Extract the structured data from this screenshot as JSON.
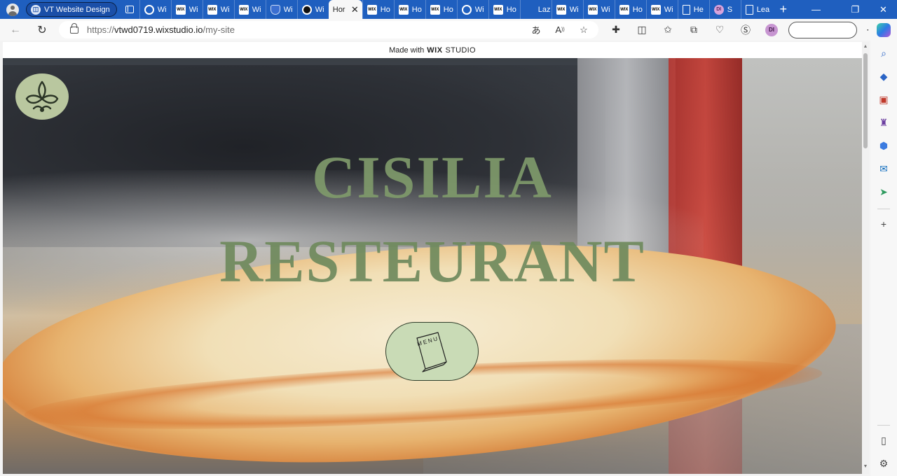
{
  "tabstrip": {
    "group_label": "VT Website Design",
    "tabs": [
      {
        "label": "Wi",
        "icon": "globe-icon"
      },
      {
        "label": "Wi",
        "icon": "wix-icon"
      },
      {
        "label": "Wi",
        "icon": "wix-icon"
      },
      {
        "label": "Wi",
        "icon": "wix-icon"
      },
      {
        "label": "Wi",
        "icon": "shield-icon"
      },
      {
        "label": "Wi",
        "icon": "circle-icon"
      },
      {
        "label": "Hor",
        "icon": "none",
        "active": true
      },
      {
        "label": "Ho",
        "icon": "wix-icon"
      },
      {
        "label": "Ho",
        "icon": "wix-icon"
      },
      {
        "label": "Ho",
        "icon": "wix-icon"
      },
      {
        "label": "Wi",
        "icon": "globe-icon"
      },
      {
        "label": "Ho",
        "icon": "wix-icon"
      },
      {
        "label": "Laz",
        "icon": "none"
      },
      {
        "label": "Wi",
        "icon": "wix-icon"
      },
      {
        "label": "Wi",
        "icon": "wix-icon"
      },
      {
        "label": "Ho",
        "icon": "wix-icon"
      },
      {
        "label": "Wi",
        "icon": "wix-icon"
      },
      {
        "label": "He",
        "icon": "page-icon"
      },
      {
        "label": "S",
        "icon": "avatar-icon",
        "avatar": "DI"
      },
      {
        "label": "Lea",
        "icon": "page-icon"
      }
    ],
    "new_tab": "+"
  },
  "toolbar": {
    "url_prefix": "https://",
    "url_host": "vtwd0719.wixstudio.io",
    "url_path": "/my-site",
    "profile_initials": "DI",
    "notification_count": "!"
  },
  "page": {
    "made_with": "Made with",
    "wix": "WIX",
    "studio": "STUDIO",
    "title_line1": "CISILIA",
    "title_line2": "RESTEURANT",
    "menu_label": "MENU"
  },
  "colors": {
    "tabstrip": "#1f5fbf",
    "title_green": "#7f9a6b",
    "menu_button": "#c9dbb6",
    "logo_circle": "#b9c79f"
  }
}
